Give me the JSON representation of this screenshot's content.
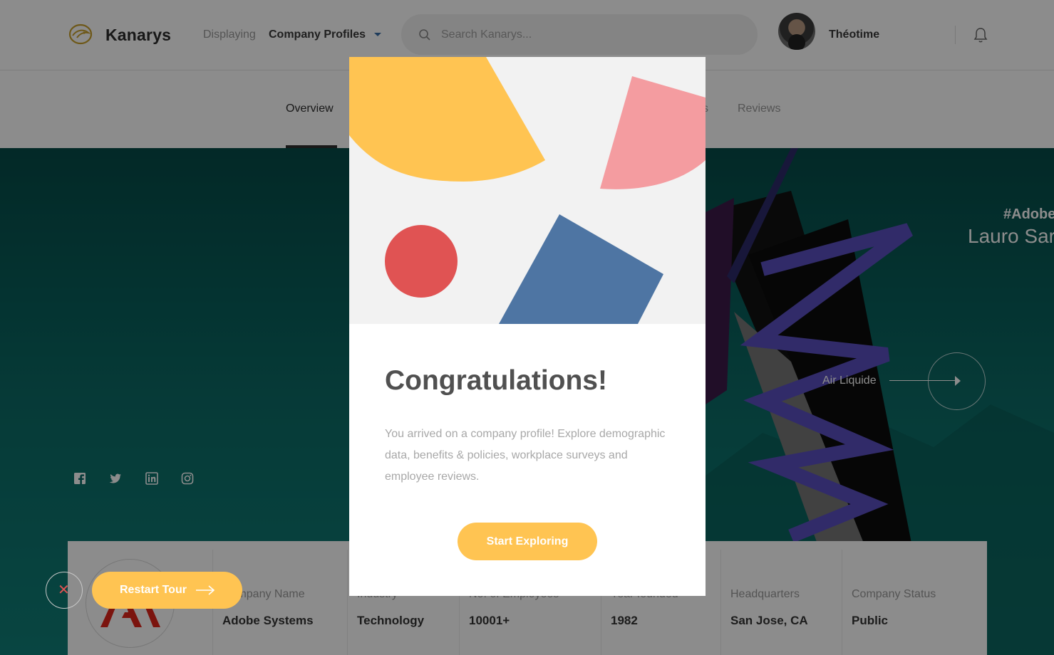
{
  "header": {
    "brand": "Kanarys",
    "displaying_label": "Displaying",
    "displaying_value": "Company Profiles",
    "search_placeholder": "Search Kanarys...",
    "user_name": "Théotime",
    "icons": {
      "logo": "kanarys-bird-logo",
      "dropdown": "chevron-down-icon",
      "search": "search-icon",
      "notifications": "bell-icon"
    }
  },
  "subnav": {
    "tabs": [
      {
        "label": "Overview",
        "active": true
      },
      {
        "label": "s",
        "active": false
      },
      {
        "label": "Reviews",
        "active": false
      }
    ]
  },
  "hero": {
    "hashtag": "#Adobe",
    "artist": "Lauro Sar",
    "next_company": "Air Liquide",
    "social_icons": [
      "facebook-icon",
      "twitter-icon",
      "linkedin-icon",
      "instagram-icon"
    ]
  },
  "company": {
    "fields": [
      {
        "label": "Company Name",
        "value": "Adobe Systems"
      },
      {
        "label": "Industry",
        "value": "Technology"
      },
      {
        "label": "No. of Employees",
        "value": "10001+"
      },
      {
        "label": "Year founded",
        "value": "1982"
      },
      {
        "label": "Headquarters",
        "value": "San Jose, CA"
      },
      {
        "label": "Company Status",
        "value": "Public"
      }
    ]
  },
  "tour": {
    "close_icon": "close-icon",
    "restart_label": "Restart Tour"
  },
  "modal": {
    "title": "Congratulations!",
    "body": "You arrived on a company profile! Explore demographic data, benefits & policies, workplace surveys and employee reviews.",
    "button_label": "Start Exploring"
  },
  "colors": {
    "accent_yellow": "#ffc452",
    "hero_teal": "#0b6b66",
    "shape_pink": "#f49ca0",
    "shape_red": "#e05353",
    "shape_blue": "#4e75a3",
    "art_purple": "#5a4fc0"
  }
}
